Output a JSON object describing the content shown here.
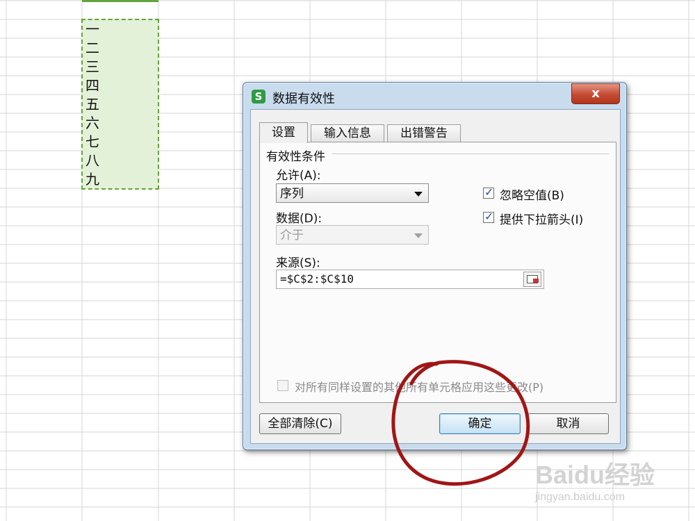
{
  "sheet": {
    "cells": [
      "一",
      "二",
      "三",
      "四",
      "五",
      "六",
      "七",
      "八",
      "九"
    ]
  },
  "dialog": {
    "app_icon": "S",
    "title": "数据有效性",
    "close_label": "x",
    "tabs": [
      {
        "label": "设置",
        "active": true
      },
      {
        "label": "输入信息",
        "active": false
      },
      {
        "label": "出错警告",
        "active": false
      }
    ],
    "group_title": "有效性条件",
    "allow_label": "允许(A):",
    "allow_value": "序列",
    "data_label": "数据(D):",
    "data_value": "介于",
    "ignore_blank_label": "忽略空值(B)",
    "ignore_blank_checked": true,
    "dropdown_label": "提供下拉箭头(I)",
    "dropdown_checked": true,
    "source_label": "来源(S):",
    "source_value": "=$C$2:$C$10",
    "apply_all_label": "对所有同样设置的其他所有单元格应用这些更改(P)",
    "apply_all_checked": false,
    "clear_all_label": "全部清除(C)",
    "ok_label": "确定",
    "cancel_label": "取消"
  },
  "watermark": {
    "logo": "Baidu经验",
    "url": "jingyan.baidu.com"
  },
  "colors": {
    "selection": "#e3f1d8",
    "selection_border": "#63a33a",
    "annotation": "#a01616"
  }
}
